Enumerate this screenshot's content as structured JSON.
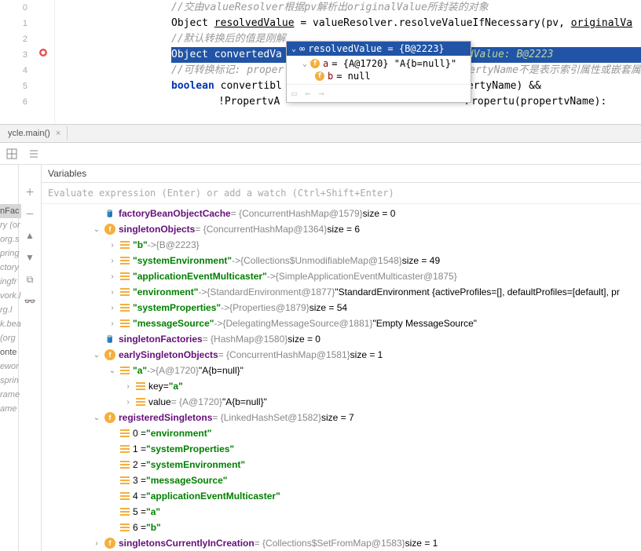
{
  "editor": {
    "lines": [
      "0",
      "1",
      "2",
      "3",
      "4",
      "5",
      "6"
    ],
    "l0": "//交由valueResolver根据pv解析出originalValue所封装的对象",
    "l1_a": "Object ",
    "l1_b": "resolvedValue",
    "l1_c": " = valueResolver.resolveValueIfNecessary(pv, ",
    "l1_d": "originalVa",
    "l2": "//默认转换后的值是刚解",
    "l3_a": "Object convertedVa",
    "l3_b": "dValue: B@2223",
    "l4_a": "//可转换标记: proper",
    "l4_b": "ertyName不是表示索引属性或嵌套属",
    "l5_a": "boolean",
    "l5_b": " convertibl",
    "l5_c": "ertyName) &&",
    "l6_a": "!PropertvA",
    "l6_b": "Propertu(propertvName):"
  },
  "tooltip": {
    "header": "resolvedValue = {B@2223}",
    "row1_name": "a",
    "row1_val": " = {A@1720} \"A{b=null}\"",
    "row2_name": "b",
    "row2_val": " = null"
  },
  "tabbar": {
    "tab1": "ycle.main()"
  },
  "leftStrip": {
    "varsTab": "Variables"
  },
  "truncated": [
    "nFac",
    "ry (or",
    "org.s",
    "pring",
    "ctory",
    "ingfr",
    "vork.l",
    "rg.l",
    "k.bea",
    "(org",
    "onte",
    "ewor",
    "sprin",
    "rame",
    "ame"
  ],
  "vars": {
    "header": "Variables",
    "evalHint": "Evaluate expression (Enter) or add a watch (Ctrl+Shift+Enter)",
    "n1": {
      "name": "factoryBeanObjectCache",
      "val": " = {ConcurrentHashMap@1579}",
      "size": "  size = 0"
    },
    "n2": {
      "name": "singletonObjects",
      "val": " = {ConcurrentHashMap@1364}",
      "size": "  size = 6"
    },
    "n2a": {
      "key": "\"b\"",
      "arrow": " -> ",
      "val": "{B@2223}"
    },
    "n2b": {
      "key": "\"systemEnvironment\"",
      "arrow": " -> ",
      "val": "{Collections$UnmodifiableMap@1548}",
      "size": "  size = 49"
    },
    "n2c": {
      "key": "\"applicationEventMulticaster\"",
      "arrow": " -> ",
      "val": "{SimpleApplicationEventMulticaster@1875}"
    },
    "n2d": {
      "key": "\"environment\"",
      "arrow": " -> ",
      "val": "{StandardEnvironment@1877}",
      "tail": " \"StandardEnvironment {activeProfiles=[], defaultProfiles=[default], pr"
    },
    "n2e": {
      "key": "\"systemProperties\"",
      "arrow": " -> ",
      "val": "{Properties@1879}",
      "size": "  size = 54"
    },
    "n2f": {
      "key": "\"messageSource\"",
      "arrow": " -> ",
      "val": "{DelegatingMessageSource@1881}",
      "tail": " \"Empty MessageSource\""
    },
    "n3": {
      "name": "singletonFactories",
      "val": " = {HashMap@1580}",
      "size": "  size = 0"
    },
    "n4": {
      "name": "earlySingletonObjects",
      "val": " = {ConcurrentHashMap@1581}",
      "size": "  size = 1"
    },
    "n4a": {
      "key": "\"a\"",
      "arrow": " -> ",
      "val": "{A@1720}",
      "tail": " \"A{b=null}\""
    },
    "n4a1": {
      "name": "key",
      "val": " = ",
      "tail": "\"a\""
    },
    "n4a2": {
      "name": "value",
      "val": " = {A@1720}",
      "tail": " \"A{b=null}\""
    },
    "n5": {
      "name": "registeredSingletons",
      "val": " = {LinkedHashSet@1582}",
      "size": "  size = 7"
    },
    "n5_0": {
      "idx": "0 = ",
      "val": "\"environment\""
    },
    "n5_1": {
      "idx": "1 = ",
      "val": "\"systemProperties\""
    },
    "n5_2": {
      "idx": "2 = ",
      "val": "\"systemEnvironment\""
    },
    "n5_3": {
      "idx": "3 = ",
      "val": "\"messageSource\""
    },
    "n5_4": {
      "idx": "4 = ",
      "val": "\"applicationEventMulticaster\""
    },
    "n5_5": {
      "idx": "5 = ",
      "val": "\"a\""
    },
    "n5_6": {
      "idx": "6 = ",
      "val": "\"b\""
    },
    "n6": {
      "name": "singletonsCurrentlyInCreation",
      "val": " = {Collections$SetFromMap@1583}",
      "size": "  size = 1"
    }
  }
}
